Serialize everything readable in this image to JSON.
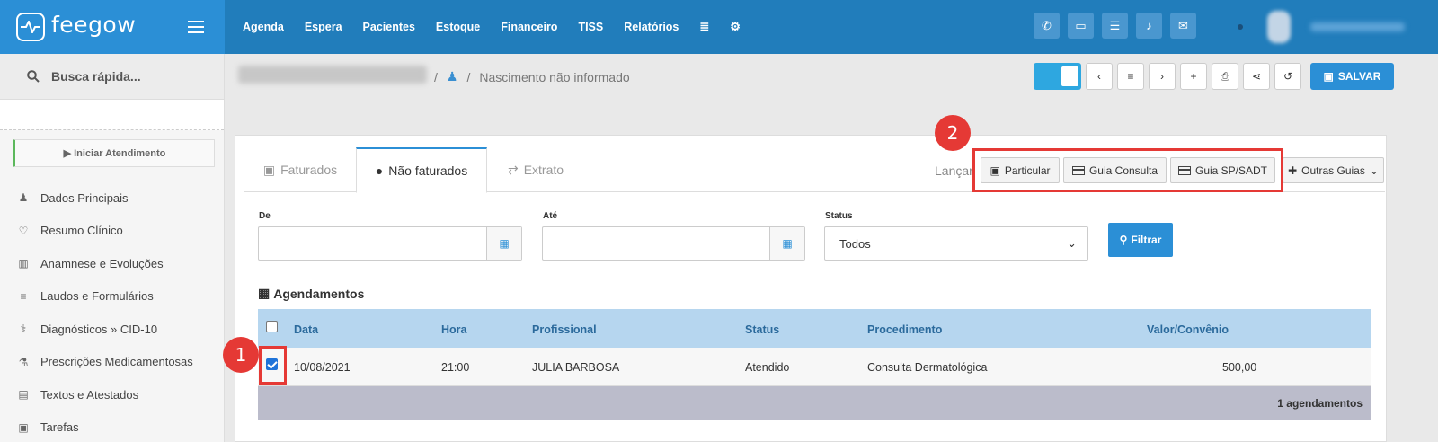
{
  "brand": {
    "name": "feegow"
  },
  "topnav": [
    "Agenda",
    "Espera",
    "Pacientes",
    "Estoque",
    "Financeiro",
    "TISS",
    "Relatórios"
  ],
  "topbar_icons": [
    "phone-icon",
    "inbox-icon",
    "card-icon",
    "bell-icon",
    "chat-icon"
  ],
  "sidebar": {
    "search": "Busca rápida...",
    "start_button": "▶ Iniciar Atendimento",
    "items": [
      {
        "label": "Dados Principais",
        "icon": "user-icon"
      },
      {
        "label": "Resumo Clínico",
        "icon": "heart-icon"
      },
      {
        "label": "Anamnese e Evoluções",
        "icon": "chart-icon"
      },
      {
        "label": "Laudos e Formulários",
        "icon": "list-icon"
      },
      {
        "label": "Diagnósticos » CID-10",
        "icon": "stethoscope-icon"
      },
      {
        "label": "Prescrições Medicamentosas",
        "icon": "flask-icon"
      },
      {
        "label": "Textos e Atestados",
        "icon": "document-icon"
      },
      {
        "label": "Tarefas",
        "icon": "task-icon"
      }
    ]
  },
  "patient": {
    "birth": "Nascimento não informado"
  },
  "toolbar": {
    "save": "SALVAR"
  },
  "tabs": {
    "faturados": "Faturados",
    "nao_faturados": "Não faturados",
    "extrato": "Extrato"
  },
  "launch": {
    "label": "Lançar",
    "particular": "Particular",
    "guia_consulta": "Guia Consulta",
    "guia_sp": "Guia SP/SADT",
    "outras": "Outras Guias"
  },
  "filters": {
    "de_label": "De",
    "ate_label": "Até",
    "status_label": "Status",
    "status_value": "Todos",
    "button": "Filtrar"
  },
  "section_title": "Agendamentos",
  "table": {
    "headers": [
      "Data",
      "Hora",
      "Profissional",
      "Status",
      "Procedimento",
      "Valor/Convênio"
    ],
    "rows": [
      {
        "data": "10/08/2021",
        "hora": "21:00",
        "profissional": "JULIA BARBOSA",
        "status": "Atendido",
        "procedimento": "Consulta Dermatológica",
        "valor": "500,00",
        "checked": true
      }
    ],
    "footer": "1 agendamentos"
  },
  "markers": [
    "1",
    "2"
  ],
  "colors": {
    "primary": "#2b8fd6",
    "topbar": "#217dbb",
    "highlight": "#e53935",
    "table_header": "#b6d6ef"
  }
}
